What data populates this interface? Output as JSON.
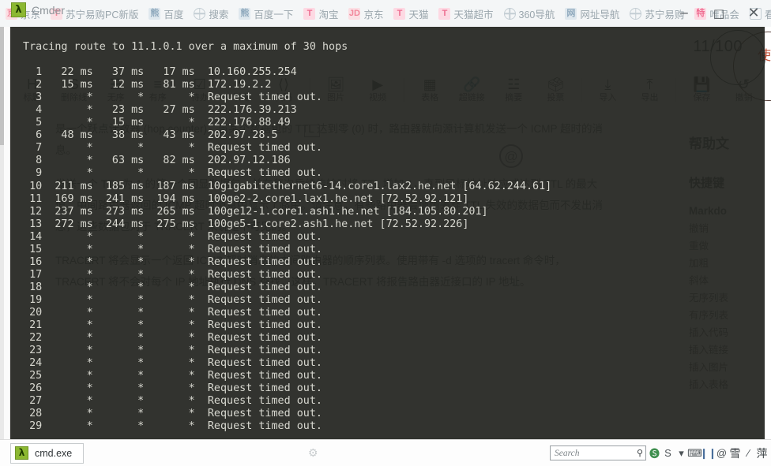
{
  "window": {
    "app_title": "Cmder",
    "lambda_glyph": "λ",
    "minimize": "─",
    "maximize": "□",
    "close": "✕"
  },
  "background_page": {
    "bookmarks": [
      {
        "label": "京东",
        "icon": "jd-icon",
        "style": "red",
        "glyph": "京"
      },
      {
        "label": "苏宁易购PC新版",
        "icon": "suning-icon",
        "style": "red",
        "glyph": "T"
      },
      {
        "label": "百度",
        "icon": "baidu-icon",
        "style": "blue",
        "glyph": "熊"
      },
      {
        "label": "搜索",
        "icon": "globe-icon",
        "style": "glob",
        "glyph": ""
      },
      {
        "label": "百度一下",
        "icon": "baidu-icon",
        "style": "blue",
        "glyph": "熊"
      },
      {
        "label": "淘宝",
        "icon": "taobao-icon",
        "style": "pink",
        "glyph": "T"
      },
      {
        "label": "京东",
        "icon": "jd-icon",
        "style": "red",
        "glyph": "JD"
      },
      {
        "label": "天猫",
        "icon": "tmall-icon",
        "style": "pink",
        "glyph": "T"
      },
      {
        "label": "天猫超市",
        "icon": "tmall-icon",
        "style": "pink",
        "glyph": "T"
      },
      {
        "label": "360导航",
        "icon": "globe-icon",
        "style": "glob",
        "glyph": ""
      },
      {
        "label": "网址导航",
        "icon": "nav-icon",
        "style": "blue",
        "glyph": "网"
      },
      {
        "label": "苏宁易购",
        "icon": "globe-icon",
        "style": "glob",
        "glyph": ""
      },
      {
        "label": "唯品会",
        "icon": "vip-icon",
        "style": "pink",
        "glyph": "特"
      },
      {
        "label": "看新闻",
        "icon": "square-icon",
        "style": "sq",
        "glyph": ""
      },
      {
        "label": "",
        "icon": "globe-icon",
        "style": "glob",
        "glyph": ""
      }
    ],
    "toolbar": [
      {
        "label": "标题",
        "glyph": "H"
      },
      {
        "label": "删除线",
        "glyph": "S"
      },
      {
        "label": "无序",
        "glyph": "☰"
      },
      {
        "label": "有序",
        "glyph": "≡"
      },
      {
        "label": "待办",
        "glyph": "☑"
      },
      {
        "label": "引用",
        "glyph": "❝"
      },
      {
        "label": "代码",
        "glyph": "⟨⟩"
      },
      {
        "label": "图片",
        "glyph": "🖼"
      },
      {
        "label": "视频",
        "glyph": "▶"
      },
      {
        "label": "表格",
        "glyph": "▦"
      },
      {
        "label": "超链接",
        "glyph": "🔗"
      },
      {
        "label": "摘要",
        "glyph": "☳"
      },
      {
        "label": "投票",
        "glyph": "🗳"
      },
      {
        "label": "导入",
        "glyph": "⤓"
      },
      {
        "label": "导出",
        "glyph": "⤒"
      },
      {
        "label": "保存",
        "glyph": "💾"
      },
      {
        "label": "撤销",
        "glyph": "↺"
      }
    ],
    "article": {
      "p1": "是一个跃点计数器 (hop counter)，当某个数据包的 TTL 达到零 (0) 时，路由器就向源计算机发送一个 ICMP 超时的消息。",
      "p2": "发送一个 TTL 为 1 的第一个回显数据包，并在每次后续传输时将 TTL 增加 1，直到目标地址响应或达到 TTL 的最大值。中间路由器返回的 ICMP 超时消息中显示了路由。请注意，有些路由器会悄悄丢弃 TTL 失效的数据包而不发出消息，这些数据包对于 TRACERT 来说是不可见的。",
      "p3": "TRACERT 将会显示一个返回 ICMP 超时消息的中间路由器的顺序列表。使用带有 -d 选项的 tracert 命令时，TRACERT 将不会对每个 IP 地址执行 DNS 查找。这样，TRACERT 将报告路由器近接口的 IP 地址。"
    },
    "help_panel": {
      "title": "帮助文",
      "subtitle": "快捷键",
      "group": "Markdo",
      "rows": [
        "撤销",
        "重做",
        "加粗",
        "斜体",
        "无序列表",
        "有序列表",
        "插入代码",
        "插入链接",
        "插入图片",
        "插入表格"
      ]
    },
    "watermark": "11/100",
    "red_mark": "使"
  },
  "terminal": {
    "tab_label": "cmd.exe",
    "header": "Tracing route to 11.1.0.1 over a maximum of 30 hops",
    "columns": [
      "hop",
      "rtt1",
      "rtt2",
      "rtt3",
      "host"
    ],
    "hops": [
      {
        "hop": "1",
        "rtt1": "22 ms",
        "rtt2": "37 ms",
        "rtt3": "17 ms",
        "host": "10.160.255.254"
      },
      {
        "hop": "2",
        "rtt1": "15 ms",
        "rtt2": "12 ms",
        "rtt3": "81 ms",
        "host": "172.19.2.2"
      },
      {
        "hop": "3",
        "rtt1": "*",
        "rtt2": "*",
        "rtt3": "*",
        "host": "Request timed out."
      },
      {
        "hop": "4",
        "rtt1": "*",
        "rtt2": "23 ms",
        "rtt3": "27 ms",
        "host": "222.176.39.213"
      },
      {
        "hop": "5",
        "rtt1": "*",
        "rtt2": "15 ms",
        "rtt3": "*",
        "host": "222.176.88.49"
      },
      {
        "hop": "6",
        "rtt1": "48 ms",
        "rtt2": "38 ms",
        "rtt3": "43 ms",
        "host": "202.97.28.5"
      },
      {
        "hop": "7",
        "rtt1": "*",
        "rtt2": "*",
        "rtt3": "*",
        "host": "Request timed out."
      },
      {
        "hop": "8",
        "rtt1": "*",
        "rtt2": "63 ms",
        "rtt3": "82 ms",
        "host": "202.97.12.186"
      },
      {
        "hop": "9",
        "rtt1": "*",
        "rtt2": "*",
        "rtt3": "*",
        "host": "Request timed out."
      },
      {
        "hop": "10",
        "rtt1": "211 ms",
        "rtt2": "185 ms",
        "rtt3": "187 ms",
        "host": "10gigabitethernet6-14.core1.lax2.he.net [64.62.244.61]"
      },
      {
        "hop": "11",
        "rtt1": "169 ms",
        "rtt2": "241 ms",
        "rtt3": "194 ms",
        "host": "100ge2-2.core1.lax1.he.net [72.52.92.121]"
      },
      {
        "hop": "12",
        "rtt1": "237 ms",
        "rtt2": "273 ms",
        "rtt3": "265 ms",
        "host": "100ge12-1.core1.ash1.he.net [184.105.80.201]"
      },
      {
        "hop": "13",
        "rtt1": "272 ms",
        "rtt2": "244 ms",
        "rtt3": "275 ms",
        "host": "100ge5-1.core2.ash1.he.net [72.52.92.226]"
      },
      {
        "hop": "14",
        "rtt1": "*",
        "rtt2": "*",
        "rtt3": "*",
        "host": "Request timed out."
      },
      {
        "hop": "15",
        "rtt1": "*",
        "rtt2": "*",
        "rtt3": "*",
        "host": "Request timed out."
      },
      {
        "hop": "16",
        "rtt1": "*",
        "rtt2": "*",
        "rtt3": "*",
        "host": "Request timed out."
      },
      {
        "hop": "17",
        "rtt1": "*",
        "rtt2": "*",
        "rtt3": "*",
        "host": "Request timed out."
      },
      {
        "hop": "18",
        "rtt1": "*",
        "rtt2": "*",
        "rtt3": "*",
        "host": "Request timed out."
      },
      {
        "hop": "19",
        "rtt1": "*",
        "rtt2": "*",
        "rtt3": "*",
        "host": "Request timed out."
      },
      {
        "hop": "20",
        "rtt1": "*",
        "rtt2": "*",
        "rtt3": "*",
        "host": "Request timed out."
      },
      {
        "hop": "21",
        "rtt1": "*",
        "rtt2": "*",
        "rtt3": "*",
        "host": "Request timed out."
      },
      {
        "hop": "22",
        "rtt1": "*",
        "rtt2": "*",
        "rtt3": "*",
        "host": "Request timed out."
      },
      {
        "hop": "23",
        "rtt1": "*",
        "rtt2": "*",
        "rtt3": "*",
        "host": "Request timed out."
      },
      {
        "hop": "24",
        "rtt1": "*",
        "rtt2": "*",
        "rtt3": "*",
        "host": "Request timed out."
      },
      {
        "hop": "25",
        "rtt1": "*",
        "rtt2": "*",
        "rtt3": "*",
        "host": "Request timed out."
      },
      {
        "hop": "26",
        "rtt1": "*",
        "rtt2": "*",
        "rtt3": "*",
        "host": "Request timed out."
      },
      {
        "hop": "27",
        "rtt1": "*",
        "rtt2": "*",
        "rtt3": "*",
        "host": "Request timed out."
      },
      {
        "hop": "28",
        "rtt1": "*",
        "rtt2": "*",
        "rtt3": "*",
        "host": "Request timed out."
      },
      {
        "hop": "29",
        "rtt1": "*",
        "rtt2": "*",
        "rtt3": "*",
        "host": "Request timed out."
      }
    ]
  },
  "statusbar": {
    "search_placeholder": "Search",
    "magnifier": "⚲",
    "gear": "⚙",
    "tray_icons": [
      {
        "name": "sogou-input-icon",
        "glyph": "🅢",
        "style": "green"
      },
      {
        "name": "sogou-s-icon",
        "glyph": "S",
        "style": "gray"
      },
      {
        "name": "dropdown-icon",
        "glyph": "▾",
        "style": "gray"
      },
      {
        "name": "keyboard-icon",
        "glyph": "⌨",
        "style": "gray"
      },
      {
        "name": "pipe-icon",
        "glyph": "❙❙",
        "style": "blue"
      },
      {
        "name": "at-icon",
        "glyph": "@",
        "style": "gray"
      },
      {
        "name": "snow-icon",
        "glyph": "雪",
        "style": "cn"
      },
      {
        "name": "slash-icon",
        "glyph": "∕",
        "style": "gray"
      },
      {
        "name": "ping-icon",
        "glyph": "萍",
        "style": "cn"
      }
    ]
  },
  "colors": {
    "terminal_bg": "#22241f",
    "terminal_fg": "#d8d8d0",
    "accent_green": "#8cb832",
    "bookmark_text": "#9aa6ad"
  }
}
